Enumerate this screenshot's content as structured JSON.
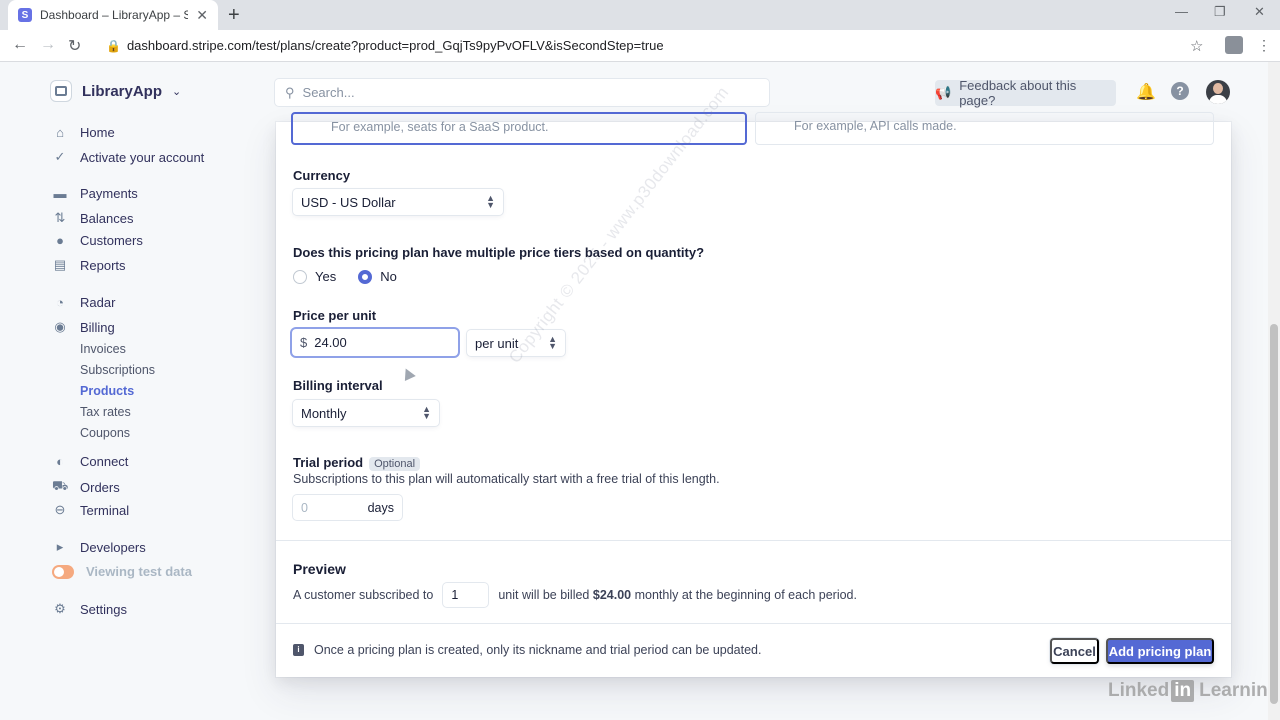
{
  "browser": {
    "tab_title": "Dashboard – LibraryApp – Stripe",
    "favicon_letter": "S",
    "url": "dashboard.stripe.com/test/plans/create?product=prod_GqjTs9pyPvOFLV&isSecondStep=true"
  },
  "brand": {
    "name": "LibraryApp"
  },
  "sidebar": {
    "items": [
      {
        "label": "Home",
        "icon": "home-icon"
      },
      {
        "label": "Activate your account",
        "icon": "check-icon"
      },
      {
        "label": "Payments",
        "icon": "payments-icon"
      },
      {
        "label": "Balances",
        "icon": "balances-icon"
      },
      {
        "label": "Customers",
        "icon": "customers-icon"
      },
      {
        "label": "Reports",
        "icon": "reports-icon"
      },
      {
        "label": "Radar",
        "icon": "radar-icon"
      },
      {
        "label": "Billing",
        "icon": "billing-icon"
      },
      {
        "label": "Connect",
        "icon": "connect-icon"
      },
      {
        "label": "Orders",
        "icon": "orders-icon"
      },
      {
        "label": "Terminal",
        "icon": "terminal-icon"
      },
      {
        "label": "Developers",
        "icon": "developers-icon"
      },
      {
        "label": "Viewing test data",
        "icon": "toggle"
      },
      {
        "label": "Settings",
        "icon": "gear-icon"
      }
    ],
    "billing_sub": [
      "Invoices",
      "Subscriptions",
      "Products",
      "Tax rates",
      "Coupons"
    ],
    "active_sub": "Products"
  },
  "topbar": {
    "search_placeholder": "Search...",
    "feedback_label": "Feedback about this page?"
  },
  "form": {
    "usage_options": [
      "For example, seats for a SaaS product.",
      "For example, API calls made."
    ],
    "currency_label": "Currency",
    "currency_value": "USD - US Dollar",
    "tiers_question": "Does this pricing plan have multiple price tiers based on quantity?",
    "tiers_yes": "Yes",
    "tiers_no": "No",
    "tiers_selected": "No",
    "price_label": "Price per unit",
    "price_currency_symbol": "$",
    "price_value": "24.00",
    "price_unit": "per unit",
    "billing_interval_label": "Billing interval",
    "billing_interval_value": "Monthly",
    "trial_label": "Trial period",
    "trial_badge": "Optional",
    "trial_help": "Subscriptions to this plan will automatically start with a free trial of this length.",
    "trial_placeholder": "0",
    "trial_unit": "days"
  },
  "preview": {
    "title": "Preview",
    "text_before": "A customer subscribed to",
    "quantity": "1",
    "text_middle": "unit will be billed",
    "amount": "$24.00",
    "text_after": "monthly at the beginning of each period."
  },
  "footer": {
    "note": "Once a pricing plan is created, only its nickname and trial period can be updated.",
    "cancel_label": "Cancel",
    "submit_label": "Add pricing plan"
  },
  "overlay": {
    "watermark": "Copyright © 2025 - www.p30download.com",
    "linkedin_pre": "Linked",
    "linkedin_in": "in",
    "linkedin_post": "Learning"
  },
  "colors": {
    "accent": "#5469d4",
    "brand": "#6772e5",
    "toggle": "#f5a97f"
  }
}
